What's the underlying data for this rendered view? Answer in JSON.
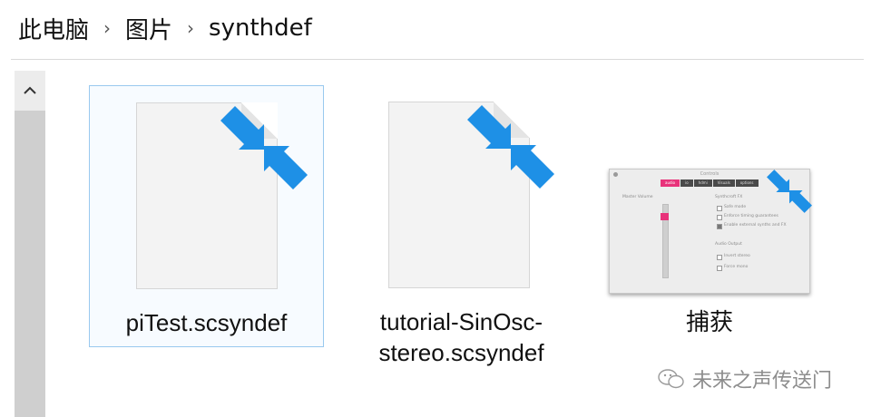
{
  "breadcrumb": {
    "items": [
      "此电脑",
      "图片",
      "synthdef"
    ],
    "separator": "›"
  },
  "files": [
    {
      "name_lines": [
        "piTest.scsyndef"
      ],
      "icon": "scsyndef-file-icon",
      "selected": true
    },
    {
      "name_lines": [
        "tutorial-SinOsc-",
        "stereo.scsyndef"
      ],
      "icon": "scsyndef-file-icon",
      "selected": false
    },
    {
      "name_lines": [
        "捕获"
      ],
      "icon": "image-thumbnail",
      "selected": false
    }
  ],
  "thumbnail": {
    "title": "Controls",
    "tabs": [
      "audio",
      "io",
      "hdmi",
      "Visuals",
      "options"
    ],
    "left_label": "Master Volume",
    "section1": "Synthcroft FX",
    "options1": [
      "Safe mode",
      "Enforce timing guarantees",
      "Enable external synths and FX"
    ],
    "section2": "Audio Output",
    "options2": [
      "Invert stereo",
      "Force mono"
    ]
  },
  "watermark": {
    "text": "未来之声传送门"
  },
  "colors": {
    "arrow_blue": "#1e90e6",
    "selection_border": "#99c9ef",
    "accent_pink": "#e8327a"
  }
}
